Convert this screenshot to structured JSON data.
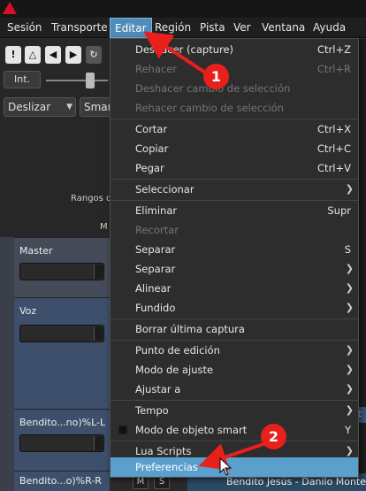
{
  "menubar": {
    "items": [
      "Sesión",
      "Transporte",
      "Editar",
      "Región",
      "Pista",
      "Ver",
      "Ventana",
      "Ayuda"
    ],
    "active": "Editar"
  },
  "toolbar": {
    "int_label": "Int.",
    "edit_mode": "Deslizar",
    "snap_mode": "Smar",
    "rangos_label": "Rangos d",
    "ma_label": "M"
  },
  "tracks": [
    {
      "name": "Master"
    },
    {
      "name": "Voz"
    },
    {
      "name": "Bendito...no)%L-L"
    },
    {
      "name": "Bendito...o)%R-R"
    }
  ],
  "strip_buttons": [
    "M",
    "S"
  ],
  "region_name": "Bendito Jesús - Danilo Montero",
  "region_partial": "Bendit",
  "edit_menu": [
    {
      "label": "Deshacer (capture)",
      "shortcut": "Ctrl+Z",
      "enabled": true
    },
    {
      "label": "Rehacer",
      "shortcut": "Ctrl+R",
      "enabled": false
    },
    {
      "label": "Deshacer cambio de selección",
      "enabled": false
    },
    {
      "label": "Rehacer cambio de selección",
      "enabled": false
    },
    {
      "label": "Cortar",
      "shortcut": "Ctrl+X",
      "enabled": true
    },
    {
      "label": "Copiar",
      "shortcut": "Ctrl+C",
      "enabled": true
    },
    {
      "label": "Pegar",
      "shortcut": "Ctrl+V",
      "enabled": true
    },
    {
      "label": "Seleccionar",
      "submenu": true
    },
    {
      "label": "Eliminar",
      "shortcut": "Supr",
      "enabled": true
    },
    {
      "label": "Recortar",
      "enabled": false
    },
    {
      "label": "Separar",
      "shortcut": "S",
      "enabled": true
    },
    {
      "label": "Separar",
      "submenu": true
    },
    {
      "label": "Alinear",
      "submenu": true
    },
    {
      "label": "Fundido",
      "submenu": true
    },
    {
      "label": "Borrar última captura",
      "enabled": true
    },
    {
      "label": "Punto de edición",
      "submenu": true
    },
    {
      "label": "Modo de ajuste",
      "submenu": true
    },
    {
      "label": "Ajustar a",
      "submenu": true
    },
    {
      "label": "Tempo",
      "submenu": true
    },
    {
      "label": "Modo de objeto smart",
      "shortcut": "Y",
      "checkbox": true
    },
    {
      "label": "Lua Scripts",
      "submenu": true
    },
    {
      "label": "Preferencias",
      "highlighted": true
    }
  ],
  "annotations": [
    {
      "number": "1"
    },
    {
      "number": "2"
    }
  ],
  "colors": {
    "accent": "#5b9fcc",
    "annotation": "#e8201c",
    "logo": "#d8102a"
  }
}
